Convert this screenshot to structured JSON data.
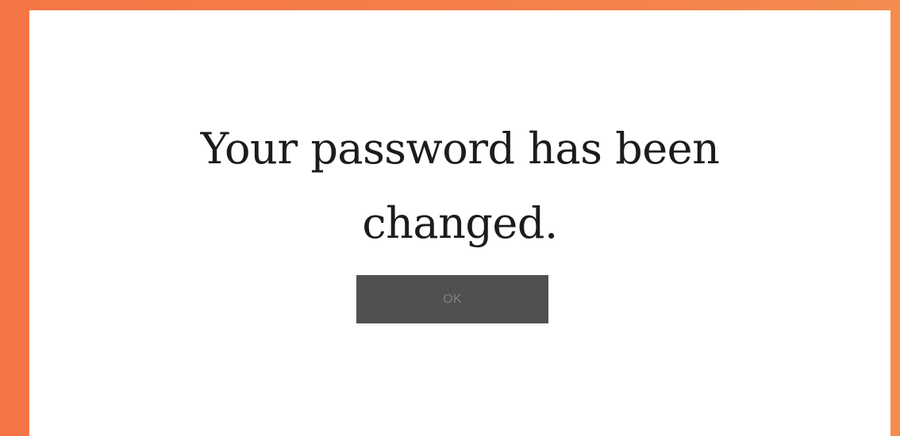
{
  "dialog": {
    "message_line1": "Your password has been",
    "message_line2": "changed.",
    "ok_label": "OK"
  },
  "colors": {
    "background_accent": "#f47646",
    "card_background": "#ffffff",
    "button_background": "#505050",
    "button_text": "#7e7e7e",
    "message_text": "#1c1c1c"
  }
}
